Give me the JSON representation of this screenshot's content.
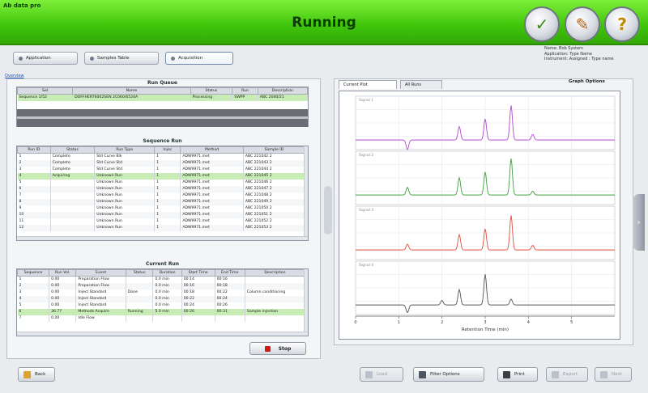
{
  "header": {
    "app_name": "Ab data pro",
    "title": "Running",
    "buttons": [
      {
        "name": "wizard",
        "glyph": "✓"
      },
      {
        "name": "tools",
        "glyph": "✎"
      },
      {
        "name": "help",
        "glyph": "?"
      }
    ],
    "info_lines": [
      "Name: Bob  System",
      "Application: Type Name",
      "Instrument: Assigned : Type name"
    ]
  },
  "tabs": [
    {
      "label": "Application"
    },
    {
      "label": "Samples Table"
    },
    {
      "label": "Acquisition"
    }
  ],
  "side_link": "Overview",
  "run_queue": {
    "title": "Run Queue",
    "columns": [
      "Sel",
      "Name",
      "Status",
      "Run",
      "Description"
    ],
    "rows": [
      [
        "Sequence 1/52",
        "DOFFHERT6002SEN 2C060/6520A",
        "Processing",
        "SWPP",
        "ABC 2040/21"
      ]
    ]
  },
  "sequence_run": {
    "title": "Sequence Run",
    "columns": [
      "Run ID",
      "Status",
      "Run Type",
      "Injec",
      "Method",
      "Sample ID"
    ],
    "rows": [
      [
        "1",
        "Complete",
        "Std Curve Blk",
        "1",
        "ADW9971.met",
        "ABC 221042  2"
      ],
      [
        "2",
        "Complete",
        "Std Curve Std",
        "1",
        "ADW9971.met",
        "ABC 221043  2"
      ],
      [
        "3",
        "Complete",
        "Std Curve Std",
        "1",
        "ADW9971.met",
        "ABC 221044  2"
      ],
      [
        "4",
        "Acquiring",
        "Unknown Run",
        "1",
        "ADW9971.met",
        "ABC 221045  2"
      ],
      [
        "5",
        "",
        "Unknown Run",
        "1",
        "ADW9971.met",
        "ABC 221046  2"
      ],
      [
        "6",
        "",
        "Unknown Run",
        "1",
        "ADW9971.met",
        "ABC 221047  2"
      ],
      [
        "7",
        "",
        "Unknown Run",
        "1",
        "ADW9971.met",
        "ABC 221048  2"
      ],
      [
        "8",
        "",
        "Unknown Run",
        "1",
        "ADW9971.met",
        "ABC 221049  2"
      ],
      [
        "9",
        "",
        "Unknown Run",
        "1",
        "ADW9971.met",
        "ABC 221050  2"
      ],
      [
        "10",
        "",
        "Unknown Run",
        "1",
        "ADW9971.met",
        "ABC 221051  2"
      ],
      [
        "11",
        "",
        "Unknown Run",
        "1",
        "ADW9971.met",
        "ABC 221052  2"
      ],
      [
        "12",
        "",
        "Unknown Run",
        "1",
        "ADW9971.met",
        "ABC 221053  2"
      ]
    ]
  },
  "current_run": {
    "title": "Current Run",
    "columns": [
      "Sequence",
      "Run Vol.",
      "Event",
      "Status",
      "Duration",
      "Start Time",
      "End Time",
      "Description"
    ],
    "rows": [
      [
        "1",
        "0.00",
        "Preparation Flow",
        "",
        "0.0 min",
        "00:14",
        "00:16",
        ""
      ],
      [
        "2",
        "0.00",
        "Preparation Flow",
        "",
        "0.0 min",
        "00:16",
        "00:18",
        ""
      ],
      [
        "3",
        "0.00",
        "Inject Standard",
        "Done",
        "0.0 min",
        "00:18",
        "00:22",
        "Column conditioning"
      ],
      [
        "4",
        "0.00",
        "Inject Standard",
        "",
        "0.0 min",
        "00:22",
        "00:24",
        ""
      ],
      [
        "5",
        "0.00",
        "Inject Standard",
        "",
        "0.0 min",
        "00:24",
        "00:26",
        ""
      ],
      [
        "6",
        "36.77",
        "Methods Acquire",
        "Running",
        "5.0 min",
        "00:26",
        "00:31",
        "Sample injection"
      ],
      [
        "7",
        "0.00",
        "Idle Flow",
        "",
        "",
        "",
        "",
        ""
      ]
    ]
  },
  "stop_label": "Stop",
  "plot_tabs": [
    {
      "label": "Current Plot"
    },
    {
      "label": "All Runs"
    }
  ],
  "graph_options": "Graph Options",
  "chart_data": {
    "type": "line",
    "x_ticks": [
      "0",
      "1",
      "2",
      "3",
      "4",
      "5"
    ],
    "xlabel": "Retention Time (min)",
    "panel_labels": [
      "Signal 1",
      "Signal 2",
      "Signal 3",
      "Signal 4"
    ],
    "series": [
      {
        "name": "Signal 1",
        "color": "#b04ad0",
        "peaks": [
          [
            1.2,
            -0.25
          ],
          [
            2.4,
            0.35
          ],
          [
            3.0,
            0.55
          ],
          [
            3.6,
            0.9
          ],
          [
            4.1,
            0.15
          ]
        ]
      },
      {
        "name": "Signal 2",
        "color": "#3f9e3a",
        "peaks": [
          [
            1.2,
            0.2
          ],
          [
            2.4,
            0.45
          ],
          [
            3.0,
            0.6
          ],
          [
            3.6,
            0.95
          ],
          [
            4.1,
            0.1
          ]
        ]
      },
      {
        "name": "Signal 3",
        "color": "#e0503c",
        "peaks": [
          [
            1.2,
            0.15
          ],
          [
            2.4,
            0.4
          ],
          [
            3.0,
            0.55
          ],
          [
            3.6,
            0.9
          ],
          [
            4.1,
            0.12
          ]
        ]
      },
      {
        "name": "Signal 4",
        "color": "#555555",
        "peaks": [
          [
            1.2,
            -0.2
          ],
          [
            2.0,
            0.12
          ],
          [
            2.4,
            0.4
          ],
          [
            3.0,
            0.8
          ],
          [
            3.6,
            0.15
          ]
        ]
      }
    ],
    "xlim": [
      0,
      6
    ],
    "grid": true
  },
  "bottom": {
    "back": "Back",
    "b1": "Load",
    "b2": "Filter Options",
    "b3": "Print",
    "b4": "Export",
    "b5": "Next"
  }
}
